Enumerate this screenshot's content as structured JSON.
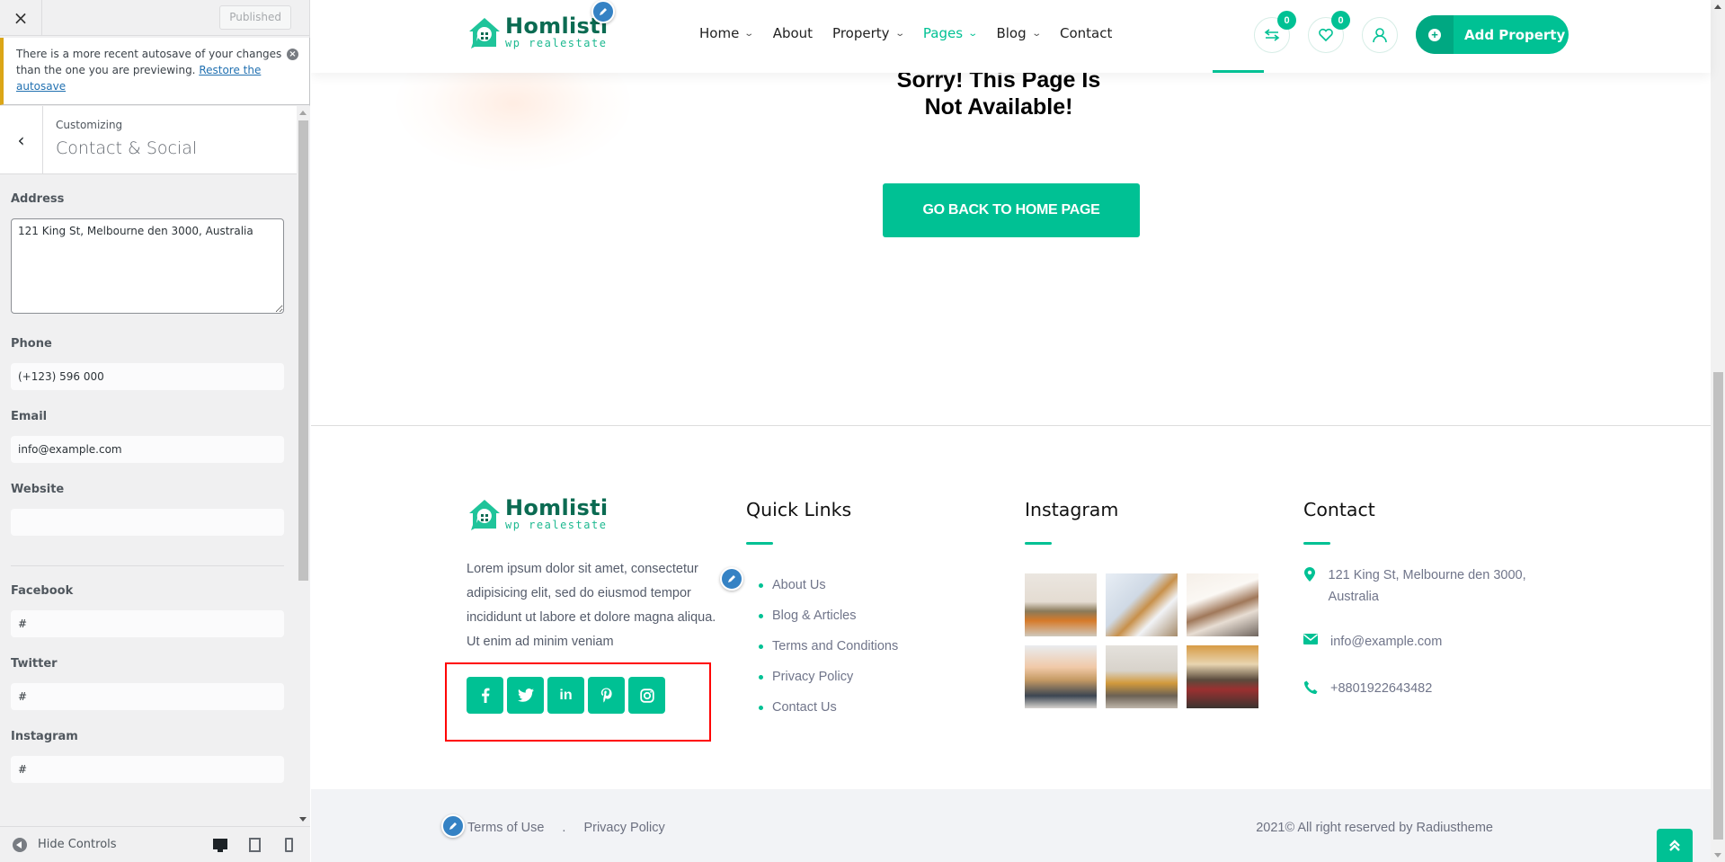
{
  "sidebar": {
    "close_label": "×",
    "publish_label": "Published",
    "notice": {
      "text": "There is a more recent autosave of your changes than the one you are previewing. ",
      "link": "Restore the autosave"
    },
    "section_small": "Customizing",
    "section_title": "Contact & Social",
    "fields": {
      "address_label": "Address",
      "address_value": "121 King St, Melbourne den 3000, Australia",
      "phone_label": "Phone",
      "phone_value": "(+123) 596 000",
      "email_label": "Email",
      "email_value": "info@example.com",
      "website_label": "Website",
      "website_value": "",
      "facebook_label": "Facebook",
      "facebook_value": "#",
      "twitter_label": "Twitter",
      "twitter_value": "#",
      "instagram_label": "Instagram",
      "instagram_value": "#"
    },
    "footer": {
      "hide_controls": "Hide Controls"
    }
  },
  "header": {
    "logo": {
      "name": "Homlisti",
      "tagline": "wp realestate"
    },
    "nav": [
      {
        "label": "Home",
        "has_dropdown": true,
        "active": false
      },
      {
        "label": "About",
        "has_dropdown": false,
        "active": false
      },
      {
        "label": "Property",
        "has_dropdown": true,
        "active": false
      },
      {
        "label": "Pages",
        "has_dropdown": true,
        "active": true
      },
      {
        "label": "Blog",
        "has_dropdown": true,
        "active": false
      },
      {
        "label": "Contact",
        "has_dropdown": false,
        "active": false
      }
    ],
    "compare_count": "0",
    "wishlist_count": "0",
    "add_property_label": "Add Property"
  },
  "error_page": {
    "title_line1": "Sorry! This Page Is",
    "title_line2": "Not Available!",
    "button_label": "GO BACK TO HOME PAGE"
  },
  "footer": {
    "logo": {
      "name": "Homlisti",
      "tagline": "wp realestate"
    },
    "description": "Lorem ipsum dolor sit amet, consectetur adipisicing elit, sed do eiusmod tempor incididunt ut labore et dolore magna aliqua. Ut enim ad minim veniam",
    "social": [
      {
        "name": "facebook",
        "glyph": "f"
      },
      {
        "name": "twitter",
        "glyph": "t"
      },
      {
        "name": "linkedin",
        "glyph": "in"
      },
      {
        "name": "pinterest",
        "glyph": "p"
      },
      {
        "name": "instagram",
        "glyph": "ig"
      }
    ],
    "quick_links_title": "Quick Links",
    "quick_links": [
      "About Us",
      "Blog & Articles",
      "Terms and Conditions",
      "Privacy Policy",
      "Contact Us"
    ],
    "instagram_title": "Instagram",
    "instagram_images": [
      "living-room",
      "staircase",
      "lamp-corner",
      "rattan-chair",
      "sofa-lounge",
      "hanging-chair"
    ],
    "contact_title": "Contact",
    "contact": {
      "address": "121 King St, Melbourne den 3000, Australia",
      "email": "info@example.com",
      "phone": "+8801922643482"
    },
    "bottom_links": [
      "Terms of Use",
      "Privacy Policy"
    ],
    "bottom_separator": ".",
    "copyright": "2021© All right reserved by Radiustheme"
  },
  "colors": {
    "accent": "#00c194",
    "accent_dark": "#00a882",
    "logo_dark": "#0b6b52",
    "edit_shortcut": "#3582c4",
    "highlight_box": "#ff0000",
    "notice_border": "#dba617"
  }
}
